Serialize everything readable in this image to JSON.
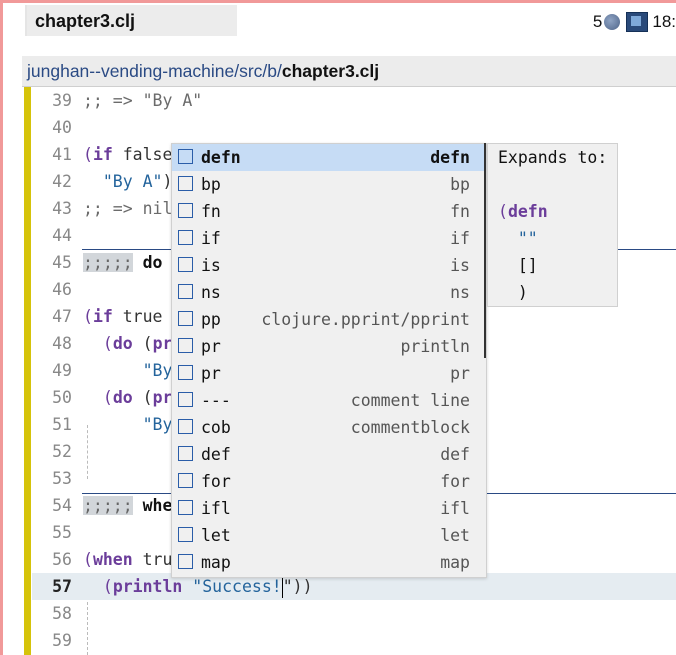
{
  "tab": {
    "title": "chapter3.clj",
    "status_left": "5",
    "status_right": "18:"
  },
  "path": {
    "dir": "junghan--vending-machine/src/b/",
    "file": "chapter3.clj"
  },
  "lines": [
    {
      "n": "39",
      "code": ";; => \"By A\""
    },
    {
      "n": "40",
      "code": ""
    },
    {
      "n": "41",
      "a": "(",
      "kw": "if",
      "b": " false"
    },
    {
      "n": "42",
      "str": "\"By A\"",
      "b": ")"
    },
    {
      "n": "43",
      "code": ";; => nil"
    },
    {
      "n": "44",
      "code": ""
    },
    {
      "n": "45",
      "sec": ";;;;;",
      "title": " do"
    },
    {
      "n": "46",
      "code": ""
    },
    {
      "n": "47",
      "a": "(",
      "kw": "if",
      "b": " true"
    },
    {
      "n": "48",
      "a": "(",
      "kw": "do",
      "b": " (",
      "kw2": "pr"
    },
    {
      "n": "49",
      "str": "\"By"
    },
    {
      "n": "50",
      "a": "(",
      "kw": "do",
      "b": " (",
      "kw2": "pr"
    },
    {
      "n": "51",
      "str": "\"By"
    },
    {
      "n": "52",
      "code": ""
    },
    {
      "n": "53",
      "code": ""
    },
    {
      "n": "54",
      "sec": ";;;;;",
      "title": " whe"
    },
    {
      "n": "55",
      "code": ""
    },
    {
      "n": "56",
      "a": "(",
      "kw": "when",
      "b": " tru"
    },
    {
      "n": "57",
      "a": "(",
      "kw": "println",
      "b": " ",
      "str": "\"Success!",
      "c": "\"))"
    },
    {
      "n": "58",
      "code": ""
    },
    {
      "n": "59",
      "code": ""
    }
  ],
  "completion": [
    {
      "name": "defn",
      "ann": "defn",
      "selected": true
    },
    {
      "name": "bp",
      "ann": "bp"
    },
    {
      "name": "fn",
      "ann": "fn"
    },
    {
      "name": "if",
      "ann": "if"
    },
    {
      "name": "is",
      "ann": "is"
    },
    {
      "name": "ns",
      "ann": "ns"
    },
    {
      "name": "pp",
      "ann": "clojure.pprint/pprint"
    },
    {
      "name": "pr",
      "ann": "println"
    },
    {
      "name": "pr",
      "ann": "pr"
    },
    {
      "name": "---",
      "ann": "comment line"
    },
    {
      "name": "cob",
      "ann": "commentblock"
    },
    {
      "name": "def",
      "ann": "def"
    },
    {
      "name": "for",
      "ann": "for"
    },
    {
      "name": "ifl",
      "ann": "ifl"
    },
    {
      "name": "let",
      "ann": "let"
    },
    {
      "name": "map",
      "ann": "map"
    }
  ],
  "doc": {
    "heading": "Expands to:",
    "l1_paren": "(",
    "l1_kw": "defn",
    "l2": "\"\"",
    "l3": "[]",
    "l4": ")"
  },
  "colors": {
    "accent": "#d5c30a",
    "frame": "#f19999",
    "keyword": "#6b3d9a",
    "string": "#24649c"
  }
}
